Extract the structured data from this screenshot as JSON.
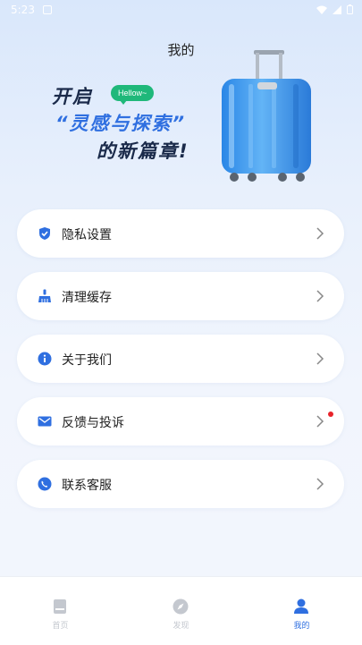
{
  "status_bar": {
    "time": "5:23"
  },
  "header": {
    "title": "我的"
  },
  "banner": {
    "line1": "开启",
    "line2": "“灵感与探索”",
    "line3": "的新篇章!",
    "bubble": "Hellow~"
  },
  "menu": {
    "items": [
      {
        "label": "隐私设置",
        "icon": "shield-check-icon"
      },
      {
        "label": "清理缓存",
        "icon": "broom-icon"
      },
      {
        "label": "关于我们",
        "icon": "info-icon"
      },
      {
        "label": "反馈与投诉",
        "icon": "mail-icon",
        "badge": true
      },
      {
        "label": "联系客服",
        "icon": "phone-icon"
      }
    ]
  },
  "tabbar": {
    "tabs": [
      {
        "label": "首页",
        "icon": "home-icon",
        "active": false
      },
      {
        "label": "发现",
        "icon": "compass-icon",
        "active": false
      },
      {
        "label": "我的",
        "icon": "user-icon",
        "active": true
      }
    ]
  },
  "colors": {
    "accent": "#2f6fe0",
    "badge": "#e8232a",
    "bubble": "#1fb87a"
  }
}
